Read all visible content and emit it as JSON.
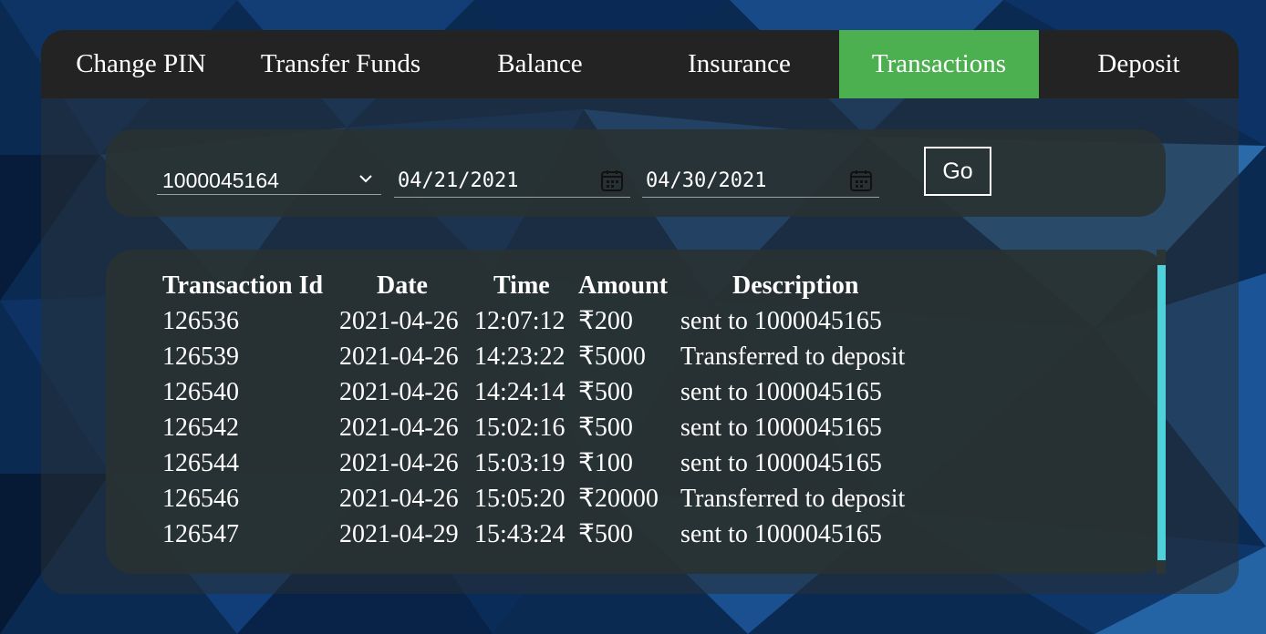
{
  "colors": {
    "nav_background": "#232323",
    "nav_active": "#4caf50",
    "panel": "#283232",
    "scrollbar_thumb": "#4fd1d9",
    "text": "#ffffff"
  },
  "nav": {
    "items": [
      {
        "label": "Change PIN",
        "active": false
      },
      {
        "label": "Transfer Funds",
        "active": false
      },
      {
        "label": "Balance",
        "active": false
      },
      {
        "label": "Insurance",
        "active": false
      },
      {
        "label": "Transactions",
        "active": true
      },
      {
        "label": "Deposit",
        "active": false
      }
    ]
  },
  "filter": {
    "account_value": "1000045164",
    "account_icon": "chevron-down-icon",
    "from_date": "04/21/2021",
    "to_date": "04/30/2021",
    "date_icon": "calendar-icon",
    "go_label": "Go"
  },
  "table": {
    "headers": {
      "id": "Transaction Id",
      "date": "Date",
      "time": "Time",
      "amount": "Amount",
      "description": "Description"
    },
    "rows": [
      {
        "id": "126536",
        "date": "2021-04-26",
        "time": "12:07:12",
        "amount": "₹200",
        "description": "sent to 1000045165"
      },
      {
        "id": "126539",
        "date": "2021-04-26",
        "time": "14:23:22",
        "amount": "₹5000",
        "description": "Transferred to deposit"
      },
      {
        "id": "126540",
        "date": "2021-04-26",
        "time": "14:24:14",
        "amount": "₹500",
        "description": "sent to 1000045165"
      },
      {
        "id": "126542",
        "date": "2021-04-26",
        "time": "15:02:16",
        "amount": "₹500",
        "description": "sent to 1000045165"
      },
      {
        "id": "126544",
        "date": "2021-04-26",
        "time": "15:03:19",
        "amount": "₹100",
        "description": "sent to 1000045165"
      },
      {
        "id": "126546",
        "date": "2021-04-26",
        "time": "15:05:20",
        "amount": "₹20000",
        "description": "Transferred to deposit"
      },
      {
        "id": "126547",
        "date": "2021-04-29",
        "time": "15:43:24",
        "amount": "₹500",
        "description": "sent to 1000045165"
      }
    ]
  }
}
